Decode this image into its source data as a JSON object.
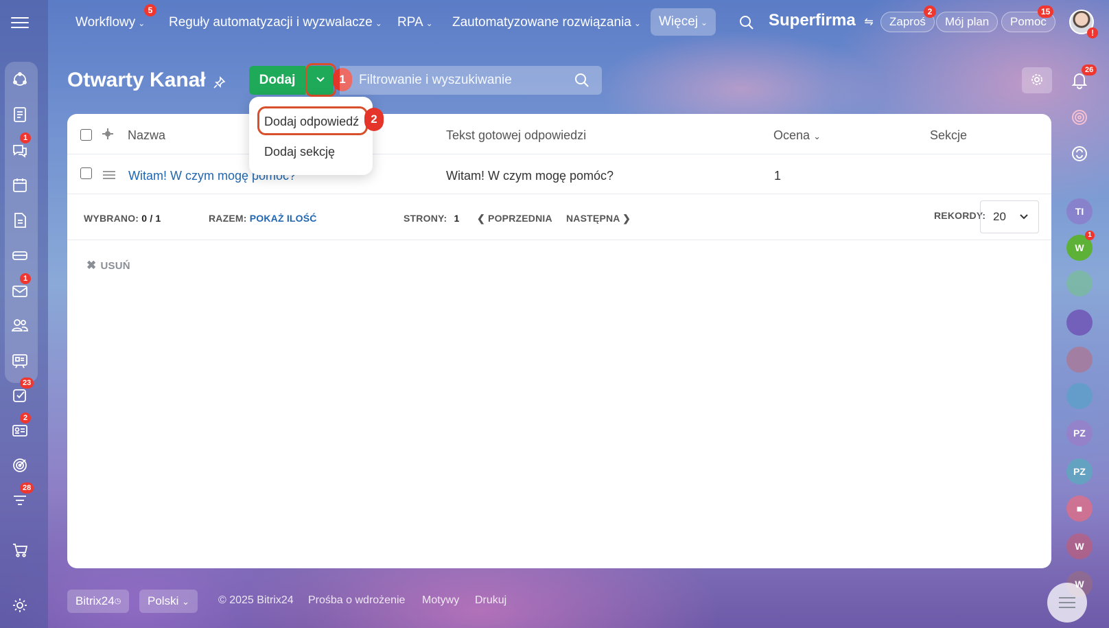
{
  "topnav": {
    "items": [
      {
        "label": "Workflowy",
        "badge": "5"
      },
      {
        "label": "Reguły automatyzacji i wyzwalacze"
      },
      {
        "label": "RPA"
      },
      {
        "label": "Zautomatyzowane rozwiązania"
      },
      {
        "label": "Więcej"
      }
    ],
    "brand": "Superfirma",
    "invite_label": "Zaproś",
    "invite_badge": "2",
    "plan_label": "Mój plan",
    "help_label": "Pomoc",
    "help_badge": "15"
  },
  "sidebar": {
    "badges": {
      "chats": "1",
      "mail": "1",
      "tasks": "23",
      "crm": "2",
      "feed": "28"
    }
  },
  "page": {
    "title": "Otwarty Kanał",
    "add_label": "Dodaj",
    "search_placeholder": "Filtrowanie i wyszukiwanie",
    "step1": "1",
    "step2": "2",
    "notifications_badge": "26"
  },
  "dropdown": {
    "items": [
      "Dodaj odpowiedź",
      "Dodaj sekcję"
    ]
  },
  "table": {
    "headers": {
      "name": "Nazwa",
      "text": "Tekst gotowej odpowiedzi",
      "rating": "Ocena",
      "sections": "Sekcje"
    },
    "rows": [
      {
        "name": "Witam! W czym mogę pomóc?",
        "text": "Witam! W czym mogę pomóc?",
        "rating": "1",
        "sections": ""
      }
    ]
  },
  "footer_bar": {
    "selected_label": "WYBRANO:",
    "selected_value": "0 / 1",
    "total_label": "RAZEM:",
    "total_link": "POKAŻ ILOŚĆ",
    "pages_label": "STRONY:",
    "pages_value": "1",
    "prev": "POPRZEDNIA",
    "next": "NASTĘPNA",
    "records_label": "REKORDY:",
    "records_value": "20",
    "delete_label": "USUŃ"
  },
  "footer": {
    "logo": "Bitrix24",
    "language": "Polski",
    "copyright": "© 2025 Bitrix24",
    "links": [
      "Prośba o wdrożenie",
      "Motywy",
      "Drukuj"
    ]
  },
  "right_bar": {
    "avatars": [
      "TI",
      "W",
      "PZ",
      "PZ",
      "W",
      "W"
    ],
    "w_badge": "1"
  },
  "colors": {
    "accent_green": "#1faa59",
    "badge_red": "#f0372f",
    "link_blue": "#2066b0",
    "highlight": "#d94e2b"
  }
}
